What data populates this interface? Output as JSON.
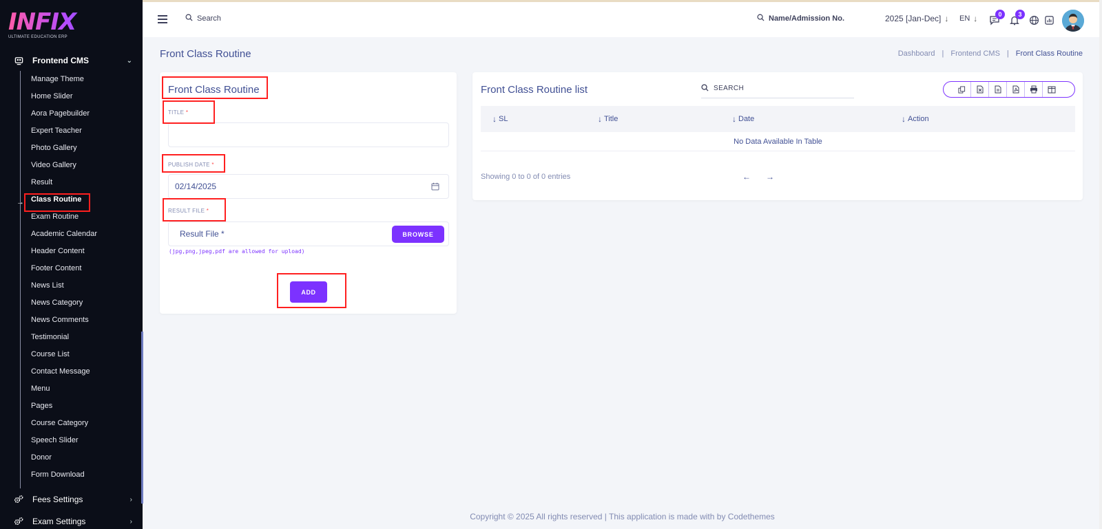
{
  "brand": {
    "logo_text": "INFIX",
    "tagline": "ULTIMATE EDUCATION ERP"
  },
  "sidebar": {
    "group_main": "Frontend CMS",
    "items": [
      {
        "label": "Manage Theme"
      },
      {
        "label": "Home Slider"
      },
      {
        "label": "Aora Pagebuilder"
      },
      {
        "label": "Expert Teacher"
      },
      {
        "label": "Photo Gallery"
      },
      {
        "label": "Video Gallery"
      },
      {
        "label": "Result"
      },
      {
        "label": "Class Routine"
      },
      {
        "label": "Exam Routine"
      },
      {
        "label": "Academic Calendar"
      },
      {
        "label": "Header Content"
      },
      {
        "label": "Footer Content"
      },
      {
        "label": "News List"
      },
      {
        "label": "News Category"
      },
      {
        "label": "News Comments"
      },
      {
        "label": "Testimonial"
      },
      {
        "label": "Course List"
      },
      {
        "label": "Contact Message"
      },
      {
        "label": "Menu"
      },
      {
        "label": "Pages"
      },
      {
        "label": "Course Category"
      },
      {
        "label": "Speech Slider"
      },
      {
        "label": "Donor"
      },
      {
        "label": "Form Download"
      }
    ],
    "active_item": "Class Routine",
    "group_fees": "Fees Settings",
    "group_exam": "Exam Settings"
  },
  "topbar": {
    "search_label": "Search",
    "admission_search": "Name/Admission No.",
    "year": "2025 [Jan-Dec]",
    "language": "EN",
    "messages_count": "0",
    "notifications_count": "3"
  },
  "page": {
    "title": "Front Class Routine",
    "breadcrumb": [
      "Dashboard",
      "Frontend CMS",
      "Front Class Routine"
    ]
  },
  "form": {
    "title": "Front Class Routine",
    "title_label": "TITLE",
    "title_value": "",
    "publish_label": "PUBLISH DATE",
    "publish_value": "02/14/2025",
    "file_label": "RESULT FILE",
    "file_placeholder": "Result File *",
    "browse_label": "BROWSE",
    "file_hint": "(jpg,png,jpeg,pdf are allowed for upload)",
    "add_label": "ADD",
    "required_mark": "*"
  },
  "list": {
    "title": "Front Class Routine list",
    "search_placeholder": "SEARCH",
    "columns": [
      "SL",
      "Title",
      "Date",
      "Action"
    ],
    "empty_text": "No Data Available In Table",
    "entries_text": "Showing 0 to 0 of 0 entries",
    "export_buttons": [
      "copy-icon",
      "excel-icon",
      "csv-icon",
      "pdf-icon",
      "print-icon",
      "columns-icon"
    ]
  },
  "footer": {
    "text": "Copyright © 2025 All rights reserved | This application is made with by Codethemes"
  },
  "colors": {
    "accent": "#7c32ff",
    "highlight": "#ff1f1f",
    "sidebar_bg": "#0b0e18",
    "text": "#415094"
  }
}
